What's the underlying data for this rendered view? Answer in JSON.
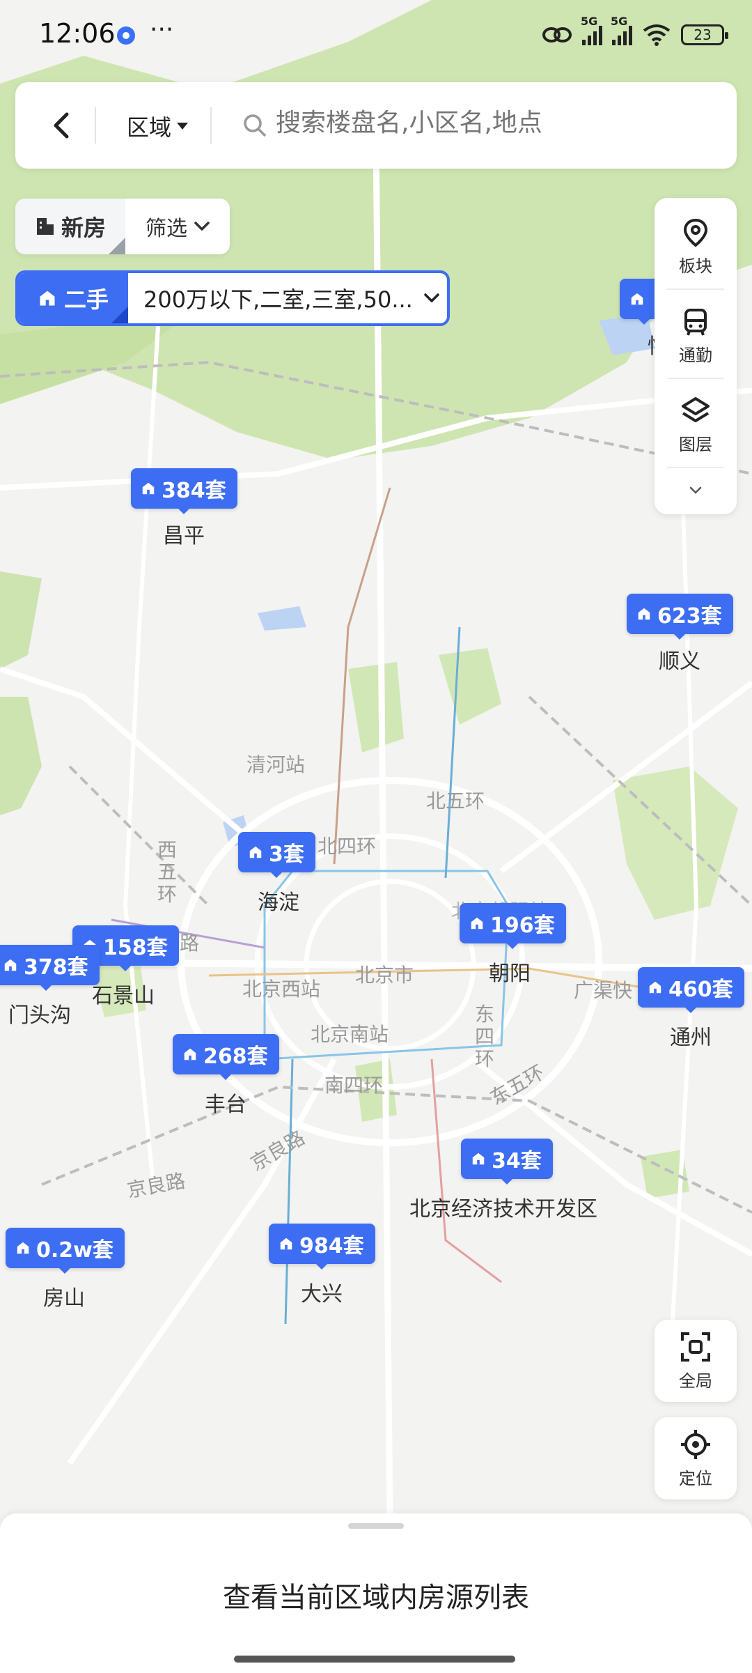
{
  "status_bar": {
    "time": "12:06",
    "more": "···",
    "net1": "5G",
    "net2": "5G",
    "battery": "23"
  },
  "search_bar": {
    "area_label": "区域",
    "placeholder": "搜索楼盘名,小区名,地点"
  },
  "filters": {
    "new_house_label": "新房",
    "filter_label": "筛选",
    "second_hand_label": "二手",
    "second_hand_conditions": "200万以下,二室,三室,50..."
  },
  "tools": [
    {
      "label": "板块",
      "icon": "map-pin-icon"
    },
    {
      "label": "通勤",
      "icon": "bus-icon"
    },
    {
      "label": "图层",
      "icon": "layers-icon"
    }
  ],
  "fab": {
    "fit_all_label": "全局",
    "locate_label": "定位"
  },
  "markers": {
    "changping": "384套",
    "shunyi": "623套",
    "haidian": "3套",
    "chaoyang": "196套",
    "shijingshan": "158套",
    "mentougou": "378套",
    "tongzhou": "460套",
    "fengtai": "268套",
    "yizhuang": "34套",
    "fangshan": "0.2w套",
    "daxing": "984套"
  },
  "districts": {
    "changping": "昌平",
    "shunyi": "顺义",
    "haidian": "海淀",
    "chaoyang": "朝阳",
    "shijingshan": "石景山",
    "mentougou": "门头沟",
    "tongzhou": "通州",
    "fengtai": "丰台",
    "yizhuang": "北京经济技术开发区",
    "fangshan": "房山",
    "daxing": "大兴",
    "cut_off": "怀"
  },
  "map_labels": {
    "qinghe": "清河站",
    "north5": "北五环",
    "north4": "北四环",
    "west5": "西五环",
    "west_station": "北京西站",
    "beijing_city": "北京市",
    "south_station": "北京南站",
    "east4": "东四环",
    "south4": "南四环",
    "east5": "东五环",
    "jingliang1": "京良路",
    "jingliang2": "京良路",
    "guangqu": "广渠快",
    "chaoyang_park": "北京朝阳站",
    "road_lu": "路"
  },
  "bottom_sheet": {
    "title": "查看当前区域内房源列表"
  },
  "colors": {
    "accent": "#3d6df2",
    "green_area": "#c9e3a8",
    "water": "#bcd3f3"
  }
}
